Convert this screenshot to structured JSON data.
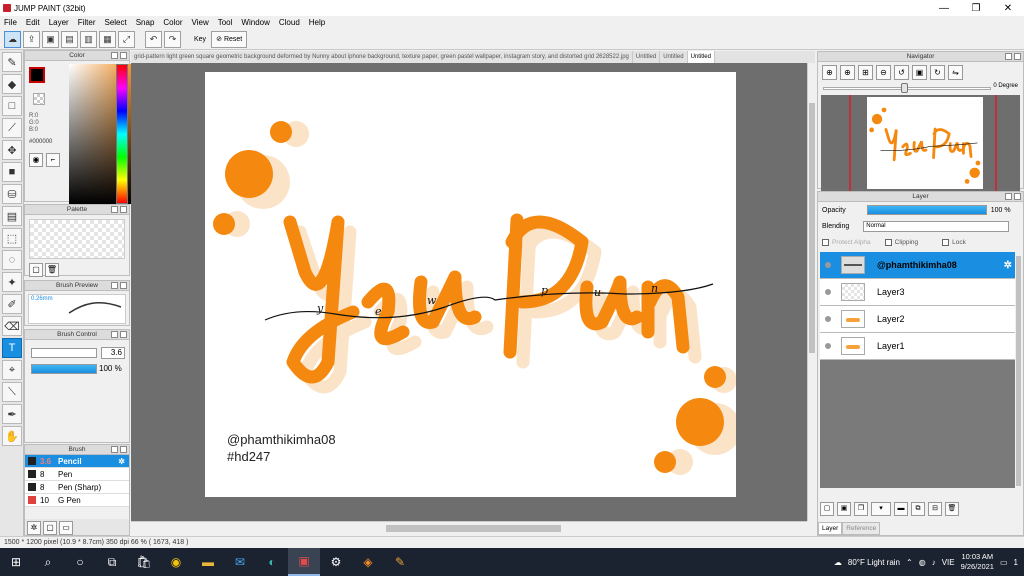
{
  "app": {
    "title": "JUMP PAINT (32bit)",
    "window_controls": [
      "—",
      "❐",
      "✕"
    ]
  },
  "menu": [
    "File",
    "Edit",
    "Layer",
    "Filter",
    "Select",
    "Snap",
    "Color",
    "View",
    "Tool",
    "Window",
    "Cloud",
    "Help"
  ],
  "toolbar": {
    "key_label": "Key",
    "reset_label": "Reset"
  },
  "color_panel": {
    "title": "Color",
    "rgb": [
      "R:0",
      "G:0",
      "B:0"
    ],
    "hex": "#000000",
    "fg_color": "#000000"
  },
  "palette_panel": {
    "title": "Palette"
  },
  "brush_preview": {
    "title": "Brush Preview",
    "size_text": "0.26mm"
  },
  "brush_control": {
    "title": "Brush Control",
    "size_value": "3.6",
    "opacity_value": "100 %",
    "size_fraction": 0.0,
    "opacity_fraction": 1.0
  },
  "brush_panel": {
    "title": "Brush",
    "items": [
      {
        "size": "3.6",
        "name": "Pencil",
        "color": "#222222",
        "selected": true
      },
      {
        "size": "8",
        "name": "Pen",
        "color": "#222222",
        "selected": false
      },
      {
        "size": "8",
        "name": "Pen (Sharp)",
        "color": "#222222",
        "selected": false
      },
      {
        "size": "10",
        "name": "G Pen",
        "color": "#e04040",
        "selected": false
      }
    ]
  },
  "doc_tabs": [
    "grid-pattern light green square geometric background deformed by Nunny about iphone background, texture paper, green pastel wallpaper, instagram story, and distorted grid 2628522.jpg",
    "Untitled",
    "Untitled",
    "Untitled"
  ],
  "canvas": {
    "signature_handle": "@phamthikimha08",
    "signature_tag": "#hd247",
    "accent_color": "#f5890f",
    "shadow_color": "#fbe3c8",
    "script_letters": [
      "y",
      "e",
      "w",
      "p",
      "u",
      "n"
    ]
  },
  "navigator": {
    "title": "Navigator",
    "rotation": "0 Degree"
  },
  "layer_panel": {
    "title": "Layer",
    "opacity_label": "Opacity",
    "opacity_value": "100 %",
    "blending_label": "Blending",
    "blending_value": "Normal",
    "protect_alpha": "Protect Alpha",
    "clipping": "Clipping",
    "lock": "Lock",
    "layers": [
      {
        "name": "@phamthikimha08",
        "thumb": "text",
        "selected": true
      },
      {
        "name": "Layer3",
        "thumb": "empty",
        "selected": false
      },
      {
        "name": "Layer2",
        "thumb": "art",
        "selected": false
      },
      {
        "name": "Layer1",
        "thumb": "art",
        "selected": false
      }
    ],
    "tabs": [
      "Layer",
      "Reference"
    ]
  },
  "status": {
    "text": "1500 * 1200 pixel   (10.9 * 8.7cm)   350 dpi   66 %   ( 1673, 418 )"
  },
  "taskbar": {
    "weather": "80°F  Light rain",
    "language": "VIE",
    "time": "10:03 AM",
    "date": "9/26/2021",
    "notification_count": "1"
  }
}
